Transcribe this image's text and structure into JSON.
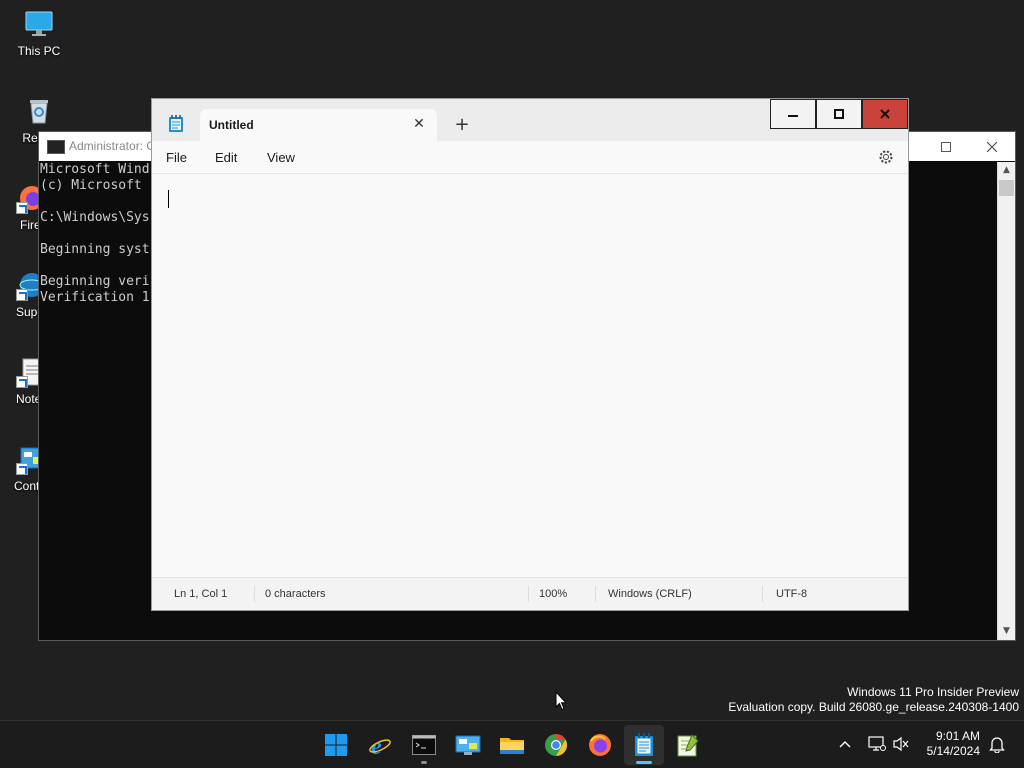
{
  "desktop": {
    "icons": [
      {
        "label": "This PC",
        "icon": "monitor-icon"
      },
      {
        "label": "Recyc",
        "icon": "recycle-bin-icon"
      },
      {
        "label": "Firef",
        "icon": "firefox-icon"
      },
      {
        "label": "Super",
        "icon": "globe-icon"
      },
      {
        "label": "Notep",
        "icon": "notepad-icon"
      },
      {
        "label": "Contro",
        "icon": "control-panel-icon"
      }
    ]
  },
  "cmd": {
    "title": "Administrator: C",
    "lines": [
      "Microsoft Wind",
      "(c) Microsoft ",
      "",
      "C:\\Windows\\Sys",
      "",
      "Beginning syst",
      "",
      "Beginning veri",
      "Verification 1"
    ]
  },
  "notepad": {
    "tab_title": "Untitled",
    "menu": {
      "file": "File",
      "edit": "Edit",
      "view": "View"
    },
    "status": {
      "position": "Ln 1, Col 1",
      "characters": "0 characters",
      "zoom": "100%",
      "line_ending": "Windows (CRLF)",
      "encoding": "UTF-8"
    }
  },
  "watermark": {
    "line1": "Windows 11 Pro Insider Preview",
    "line2": "Evaluation copy. Build 26080.ge_release.240308-1400"
  },
  "taskbar": {
    "apps": [
      {
        "name": "start-button",
        "icon": "windows-logo-icon"
      },
      {
        "name": "taskbar-internet-explorer",
        "icon": "internet-explorer-icon"
      },
      {
        "name": "taskbar-command-prompt",
        "icon": "terminal-icon"
      },
      {
        "name": "taskbar-control-panel",
        "icon": "control-panel-icon"
      },
      {
        "name": "taskbar-file-explorer",
        "icon": "folder-icon"
      },
      {
        "name": "taskbar-chrome",
        "icon": "chrome-icon"
      },
      {
        "name": "taskbar-firefox",
        "icon": "firefox-icon"
      },
      {
        "name": "taskbar-notepad",
        "icon": "notepad-icon"
      },
      {
        "name": "taskbar-notepadpp",
        "icon": "notepadpp-icon"
      }
    ],
    "clock": {
      "time": "9:01 AM",
      "date": "5/14/2024"
    }
  }
}
